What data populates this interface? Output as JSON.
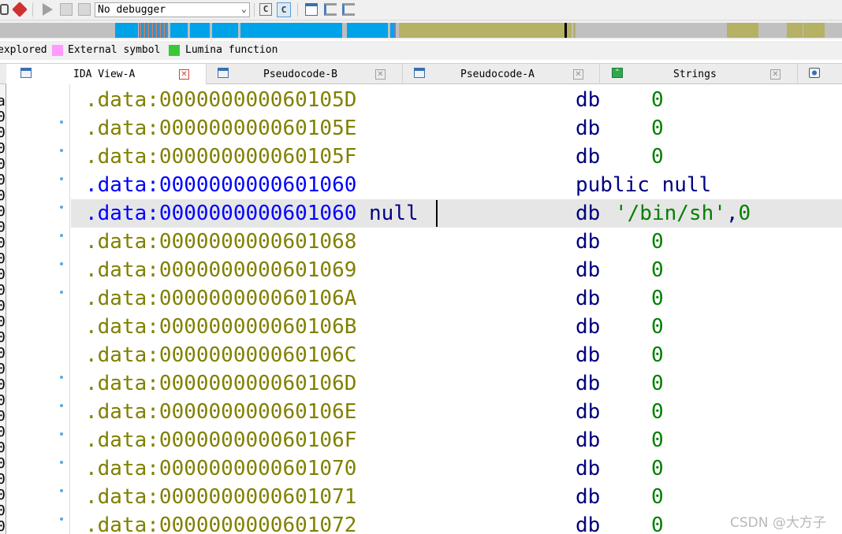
{
  "toolbar": {
    "debugger_select": "No debugger",
    "icons": [
      "debug-attach-icon",
      "stop-sign-icon",
      "play-icon",
      "pause-icon",
      "stop-icon",
      "pseudocode-c-icon",
      "pseudocode-c-active-icon",
      "breakpoint-list-icon",
      "step-into-icon",
      "step-over-icon"
    ]
  },
  "navband": {
    "colors": {
      "library": "#00a2e8",
      "regular": "#5b86c6",
      "data": "#b5b165",
      "unexplored": "#bdbdbd",
      "cursor": "#000000"
    }
  },
  "legend": {
    "items": [
      {
        "label": "explored",
        "color": null
      },
      {
        "label": "External symbol",
        "color": "#ff9bff"
      },
      {
        "label": "Lumina function",
        "color": "#38c838"
      }
    ]
  },
  "tabs": [
    {
      "label": "IDA View-A",
      "active": true
    },
    {
      "label": "Pseudocode-B",
      "active": false
    },
    {
      "label": "Pseudocode-A",
      "active": false
    },
    {
      "label": "Strings",
      "active": false
    }
  ],
  "left_strip_chars": [
    "a",
    "0",
    "0",
    "0",
    "0",
    "0",
    "0",
    "0",
    "0",
    "0",
    "0",
    "0",
    "0",
    "0",
    "0",
    "0",
    "0",
    "0",
    "0",
    "0",
    "0",
    "0",
    "0",
    "0",
    "0",
    "0",
    "0",
    "0"
  ],
  "listing": {
    "rows": [
      {
        "addr": ".data:000000000060105D",
        "label": "",
        "mnem": "db",
        "oper": "0",
        "dot": false,
        "kind": "normal"
      },
      {
        "addr": ".data:000000000060105E",
        "label": "",
        "mnem": "db",
        "oper": "0",
        "dot": true,
        "kind": "normal"
      },
      {
        "addr": ".data:000000000060105F",
        "label": "",
        "mnem": "db",
        "oper": "0",
        "dot": true,
        "kind": "normal"
      },
      {
        "addr": ".data:0000000000601060",
        "label": "",
        "mnem": "public null",
        "oper": "",
        "dot": true,
        "kind": "public"
      },
      {
        "addr": ".data:0000000000601060",
        "label": " null",
        "mnem": "db",
        "oper": "'/bin/sh',0",
        "dot": true,
        "kind": "string"
      },
      {
        "addr": ".data:0000000000601068",
        "label": "",
        "mnem": "db",
        "oper": "0",
        "dot": true,
        "kind": "normal"
      },
      {
        "addr": ".data:0000000000601069",
        "label": "",
        "mnem": "db",
        "oper": "0",
        "dot": true,
        "kind": "normal"
      },
      {
        "addr": ".data:000000000060106A",
        "label": "",
        "mnem": "db",
        "oper": "0",
        "dot": true,
        "kind": "normal"
      },
      {
        "addr": ".data:000000000060106B",
        "label": "",
        "mnem": "db",
        "oper": "0",
        "dot": false,
        "kind": "normal"
      },
      {
        "addr": ".data:000000000060106C",
        "label": "",
        "mnem": "db",
        "oper": "0",
        "dot": false,
        "kind": "normal"
      },
      {
        "addr": ".data:000000000060106D",
        "label": "",
        "mnem": "db",
        "oper": "0",
        "dot": true,
        "kind": "normal"
      },
      {
        "addr": ".data:000000000060106E",
        "label": "",
        "mnem": "db",
        "oper": "0",
        "dot": true,
        "kind": "normal"
      },
      {
        "addr": ".data:000000000060106F",
        "label": "",
        "mnem": "db",
        "oper": "0",
        "dot": true,
        "kind": "normal"
      },
      {
        "addr": ".data:0000000000601070",
        "label": "",
        "mnem": "db",
        "oper": "0",
        "dot": true,
        "kind": "normal"
      },
      {
        "addr": ".data:0000000000601071",
        "label": "",
        "mnem": "db",
        "oper": "0",
        "dot": true,
        "kind": "normal"
      },
      {
        "addr": ".data:0000000000601072",
        "label": "",
        "mnem": "db",
        "oper": "0",
        "dot": true,
        "kind": "normal"
      }
    ]
  },
  "watermark": "CSDN @大方子"
}
